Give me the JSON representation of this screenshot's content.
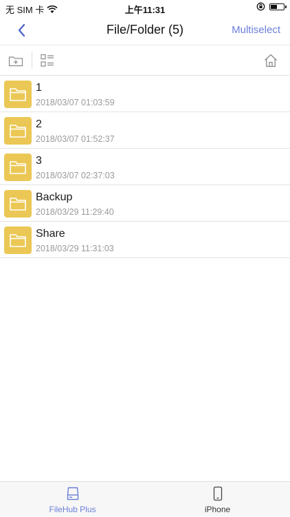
{
  "status_bar": {
    "carrier": "无 SIM 卡",
    "time": "上午11:31",
    "battery_level": 0.55
  },
  "nav": {
    "title": "File/Folder (5)",
    "action_label": "Multiselect",
    "accent_color": "#6a7ed8"
  },
  "toolbar": {
    "icons": [
      "add-folder-icon",
      "list-view-icon",
      "home-icon"
    ]
  },
  "files": [
    {
      "name": "1",
      "date": "2018/03/07 01:03:59",
      "icon": "folder-icon"
    },
    {
      "name": "2",
      "date": "2018/03/07 01:52:37",
      "icon": "folder-icon"
    },
    {
      "name": "3",
      "date": "2018/03/07 02:37:03",
      "icon": "folder-icon"
    },
    {
      "name": "Backup",
      "date": "2018/03/29 11:29:40",
      "icon": "folder-icon"
    },
    {
      "name": "Share",
      "date": "2018/03/29 11:31:03",
      "icon": "folder-icon"
    }
  ],
  "folder_color": "#ebc855",
  "tabs": [
    {
      "label": "FileHub Plus",
      "icon": "hard-drive-icon",
      "active": true,
      "color": "#6a7ed8"
    },
    {
      "label": "iPhone",
      "icon": "phone-icon",
      "active": false,
      "color": "#333333"
    }
  ]
}
